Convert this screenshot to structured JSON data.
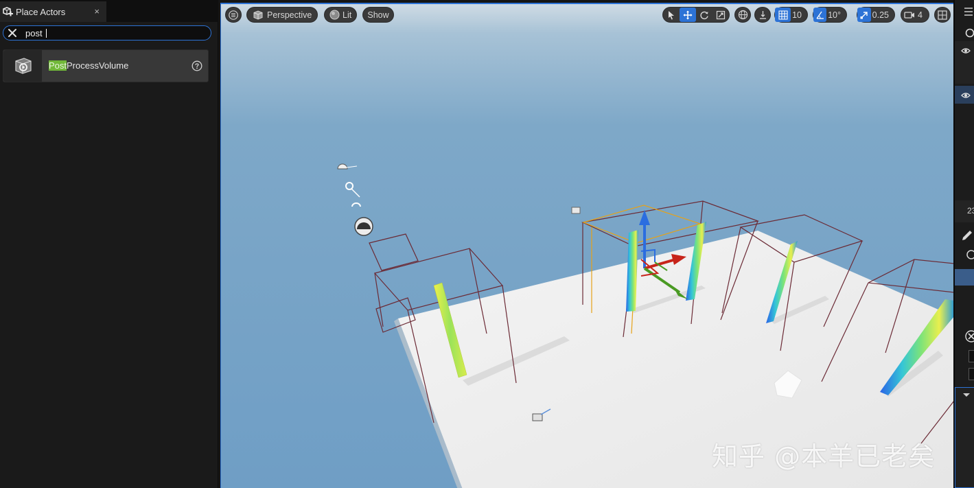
{
  "panel": {
    "tab_title": "Place Actors",
    "tab_close": "×",
    "tab_icon": "place-actors-icon",
    "search": {
      "value": "post",
      "clear_icon": "close-icon"
    },
    "results": [
      {
        "match": "Post",
        "rest": "ProcessVolume",
        "icon": "post-process-volume-icon",
        "help_icon": "help-icon"
      }
    ]
  },
  "viewport": {
    "menu_icon": "hamburger-menu-icon",
    "view_mode": "Perspective",
    "lighting": "Lit",
    "show": "Show",
    "grid_snap": "10",
    "rotation_snap": "10°",
    "scale_snap": "0.25",
    "camera_speed": "4",
    "watermark": "知乎 @本羊已老矣"
  },
  "right_panel": {
    "partial_number": "23"
  },
  "colors": {
    "accent": "#2d73d6",
    "match_highlight": "#71b839",
    "panel_bg": "#1a1a1a",
    "sky": "#7ea8c8",
    "floor": "#ececec"
  }
}
